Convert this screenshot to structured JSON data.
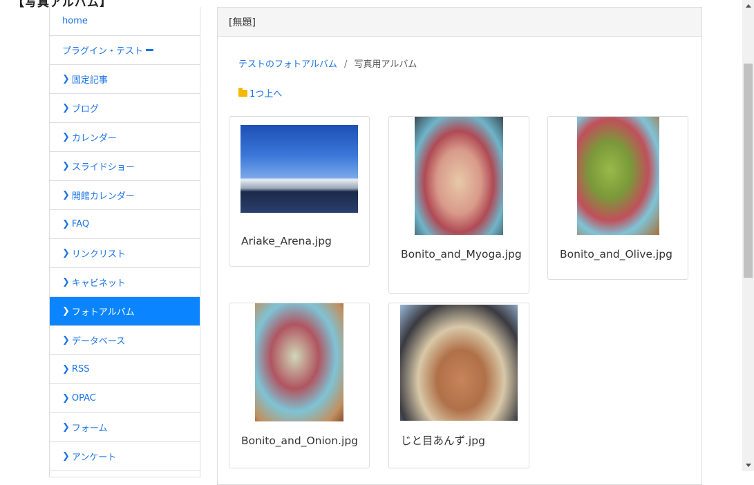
{
  "page": {
    "top_heading": "【写真アルバム】"
  },
  "sidebar": {
    "items": [
      {
        "label": "home",
        "chevron": false,
        "active": false
      },
      {
        "label": "プラグイン・テスト",
        "chevron": false,
        "active": false,
        "dash": true
      },
      {
        "label": "固定記事",
        "chevron": true,
        "active": false
      },
      {
        "label": "ブログ",
        "chevron": true,
        "active": false
      },
      {
        "label": "カレンダー",
        "chevron": true,
        "active": false
      },
      {
        "label": "スライドショー",
        "chevron": true,
        "active": false
      },
      {
        "label": "開館カレンダー",
        "chevron": true,
        "active": false
      },
      {
        "label": "FAQ",
        "chevron": true,
        "active": false
      },
      {
        "label": "リンクリスト",
        "chevron": true,
        "active": false
      },
      {
        "label": "キャビネット",
        "chevron": true,
        "active": false
      },
      {
        "label": "フォトアルバム",
        "chevron": true,
        "active": true
      },
      {
        "label": "データベース",
        "chevron": true,
        "active": false
      },
      {
        "label": "RSS",
        "chevron": true,
        "active": false
      },
      {
        "label": "OPAC",
        "chevron": true,
        "active": false
      },
      {
        "label": "フォーム",
        "chevron": true,
        "active": false
      },
      {
        "label": "アンケート",
        "chevron": true,
        "active": false
      }
    ],
    "chevron_glyph": "❯"
  },
  "panel": {
    "title": "[無題]",
    "breadcrumb": {
      "parent": "テストのフォトアルバム",
      "separator": "/",
      "current": "写真用アルバム"
    },
    "up_link": "1つ上へ",
    "photos": [
      {
        "filename": "Ariake_Arena.jpg"
      },
      {
        "filename": "Bonito_and_Myoga.jpg"
      },
      {
        "filename": "Bonito_and_Olive.jpg"
      },
      {
        "filename": "Bonito_and_Onion.jpg"
      },
      {
        "filename": "じと目あんず.jpg"
      }
    ]
  },
  "colors": {
    "accent": "#0a84ff",
    "link": "#1a73e8",
    "folder": "#f5b800"
  }
}
